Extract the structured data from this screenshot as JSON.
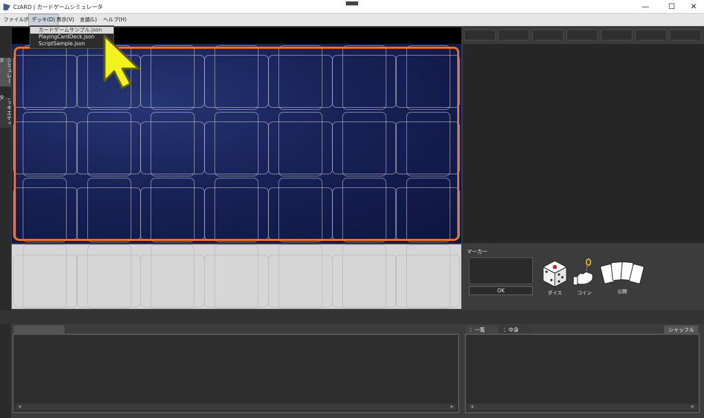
{
  "window": {
    "title": "CzARD | カードゲームシミュレータ",
    "minimize_glyph": "—",
    "maximize_glyph": "☐",
    "close_glyph": "✕"
  },
  "menubar": {
    "items": [
      "ファイル(F)",
      "デッキ(D)",
      "表示(V)",
      "言語(L)",
      "ヘルプ(H)"
    ]
  },
  "deck_menu": {
    "options": [
      "カードゲームサンプル.json",
      "PlayingCardDeck.json",
      "ScriptSample.json"
    ],
    "highlighted": "カードゲームサンプル.json"
  },
  "side_tabs": {
    "simulator": "シミュレータ",
    "deck_editor": "デッキエディタ"
  },
  "marker_panel": {
    "label": "マーカー",
    "ok_label": "OK",
    "dice_label": "ダイス",
    "coin_label": "コイン",
    "reveal_label": "公開"
  },
  "bottom_tabs": {
    "list": "：一覧",
    "contents": "：中身",
    "shuffle": "シャッフル"
  },
  "icons": {
    "app": "czard-app-icon",
    "dice": "dice-icon",
    "coin": "coin-flip-icon",
    "reveal": "card-fan-icon",
    "cursor": "pointer-arrow-icon"
  },
  "colors": {
    "field_border": "#e8742c",
    "field_bg": "#172257",
    "cursor_fill": "#f2f21e"
  }
}
